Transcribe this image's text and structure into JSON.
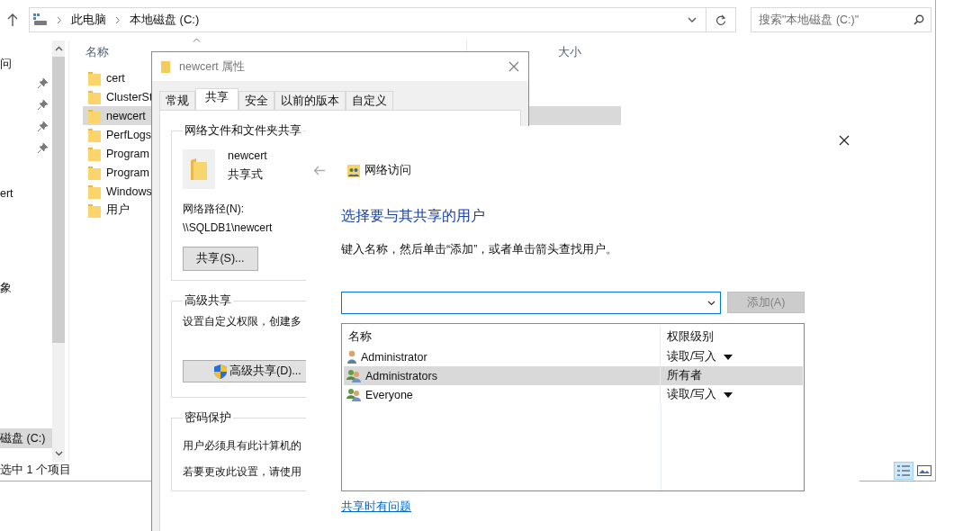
{
  "explorer": {
    "breadcrumbs": [
      "此电脑",
      "本地磁盘 (C:)"
    ],
    "search": {
      "placeholder": "搜索\"本地磁盘 (C:)\""
    },
    "nav_items": [
      {
        "label": "问",
        "selected": false,
        "pinned": false
      },
      {
        "selected": false,
        "pinned": true
      },
      {
        "label": "ert",
        "selected": false,
        "pinned": false
      },
      {
        "label": "象",
        "selected": false,
        "pinned": false
      },
      {
        "label": "磁盘 (C:)",
        "selected": true,
        "pinned": false
      }
    ],
    "columns": [
      "名称",
      "大小"
    ],
    "files": [
      {
        "name": "cert",
        "selected": false
      },
      {
        "name": "ClusterSt",
        "selected": false
      },
      {
        "name": "newcert",
        "selected": true
      },
      {
        "name": "PerfLogs",
        "selected": false
      },
      {
        "name": "Program",
        "selected": false
      },
      {
        "name": "Program",
        "selected": false
      },
      {
        "name": "Windows",
        "selected": false
      },
      {
        "name": "用户",
        "selected": false
      }
    ],
    "status": "选中 1 个项目"
  },
  "properties_dialog": {
    "title": "newcert 属性",
    "tabs": [
      {
        "label": "常规",
        "selected": false
      },
      {
        "label": "共享",
        "selected": true
      },
      {
        "label": "安全",
        "selected": false
      },
      {
        "label": "以前的版本",
        "selected": false
      },
      {
        "label": "自定义",
        "selected": false
      }
    ],
    "network_sharing": {
      "title": "网络文件和文件夹共享",
      "folder_name": "newcert",
      "share_state": "共享式",
      "path_label": "网络路径(N):",
      "path": "\\\\SQLDB1\\newcert",
      "button": "共享(S)..."
    },
    "advanced_sharing": {
      "title": "高级共享",
      "text": "设置自定义权限，创建多",
      "button": "高级共享(D)..."
    },
    "password_protection": {
      "title": "密码保护",
      "lines": [
        "用户必须具有此计算机的",
        "若要更改此设置，请使用"
      ]
    }
  },
  "network_access_wizard": {
    "title": "网络访问",
    "heading": "选择要与其共享的用户",
    "instruction": "键入名称，然后单击“添加”，或者单击箭头查找用户。",
    "add_button": {
      "label": "添加(A)",
      "disabled": true
    },
    "table": {
      "columns": [
        "名称",
        "权限级别"
      ],
      "rows": [
        {
          "name": "Administrator",
          "kind": "user",
          "permission": "读取/写入",
          "has_menu": true,
          "selected": false
        },
        {
          "name": "Administrators",
          "kind": "group",
          "permission": "所有者",
          "has_menu": false,
          "selected": true
        },
        {
          "name": "Everyone",
          "kind": "group",
          "permission": "读取/写入",
          "has_menu": true,
          "selected": false
        }
      ]
    },
    "help_link": "共享时有问题"
  }
}
